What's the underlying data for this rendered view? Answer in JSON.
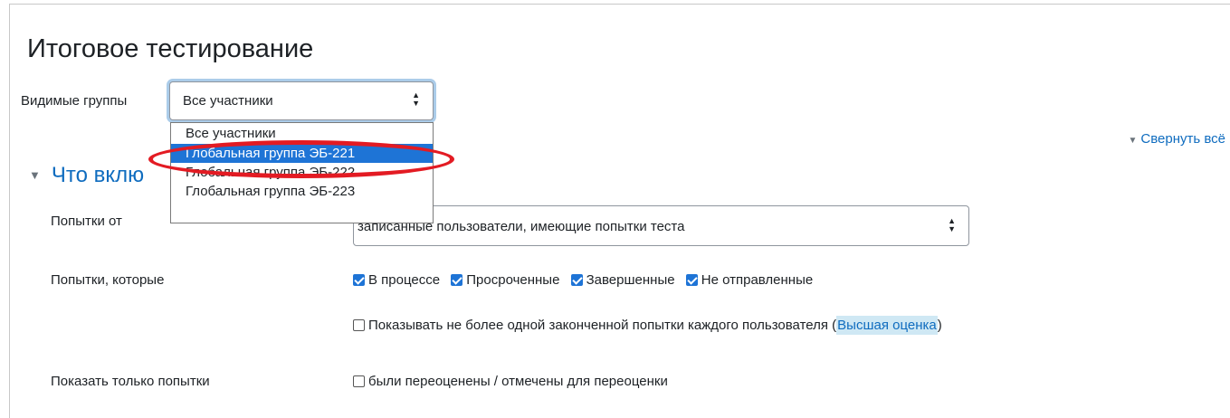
{
  "page_title": "Итоговое тестирование",
  "groups": {
    "label": "Видимые группы",
    "selected": "Все участники",
    "options": [
      "Все участники",
      "Глобальная группа ЭБ-221",
      "Глобальная группа ЭБ-222",
      "Глобальная группа ЭБ-223"
    ],
    "highlighted_option": "Глобальная группа ЭБ-221"
  },
  "collapse_all": "Свернуть всё",
  "section": {
    "title": "Что вклю"
  },
  "attempts_from": {
    "label": "Попытки от",
    "value": "записанные пользователи, имеющие попытки теста"
  },
  "attempts_that": {
    "label": "Попытки, которые",
    "checkboxes": [
      {
        "label": "В процессе",
        "checked": true
      },
      {
        "label": "Просроченные",
        "checked": true
      },
      {
        "label": "Завершенные",
        "checked": true
      },
      {
        "label": "Не отправленные",
        "checked": true
      }
    ]
  },
  "one_attempt": {
    "text_before": "Показывать не более одной законченной попытки каждого пользователя (",
    "link": "Высшая оценка",
    "text_after": ")",
    "checked": false
  },
  "show_only": {
    "label": "Показать только попытки",
    "checkbox_label": "были переоценены / отмечены для переоценки",
    "checked": false
  },
  "colors": {
    "accent": "#0f6cbf",
    "selected_option": "#1e74d6",
    "highlight_oval": "#e31b23"
  }
}
